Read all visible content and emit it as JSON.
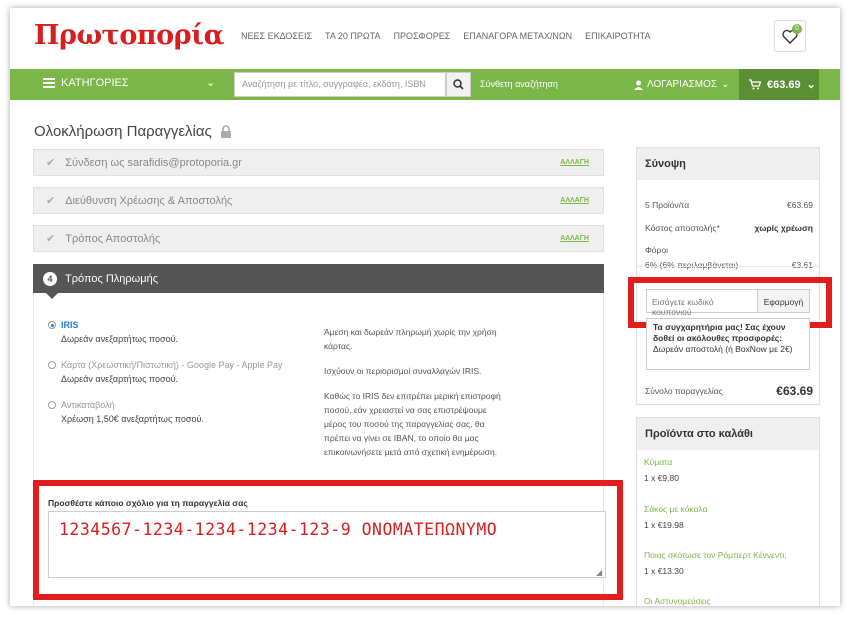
{
  "header": {
    "logo": "Πρωτοπορία",
    "nav": [
      "ΝΕΕΣ ΕΚΔΟΣΕΙΣ",
      "ΤΑ 20 ΠΡΩΤΑ",
      "ΠΡΟΣΦΟΡΕΣ",
      "ΕΠΑΝΑΓΟΡΑ ΜΕΤΑΧ/ΝΩΝ",
      "ΕΠΙΚΑΙΡΟΤΗΤΑ"
    ],
    "wishlist_count": "0"
  },
  "greenbar": {
    "categories_label": "ΚΑΤΗΓΟΡΙΕΣ",
    "search_placeholder": "Αναζήτηση με τίτλο, συγγραφέα, εκδότη, ISBN",
    "advanced_search": "Σύνθετη αναζήτηση",
    "account_label": "ΛΟΓΑΡΙΑΣΜΟΣ",
    "cart_total": "€63.69",
    "cart_count": "5"
  },
  "page": {
    "title": "Ολοκλήρωση Παραγγελίας",
    "change_label": "ΑΛΛΑΓΗ",
    "steps": [
      "Σύνδεση ως sarafidis@protoporia.gr",
      "Διεύθυνση Χρέωσης & Αποστολής",
      "Τρόπος Αποστολής"
    ],
    "payment": {
      "number": "4",
      "title": "Τρόπος Πληρωμής",
      "options": [
        {
          "name": "IRIS",
          "sub": "Δωρεάν ανεξαρτήτως ποσού.",
          "selected": true
        },
        {
          "name": "Κάρτα (Χρεωστική/Πιστωτική) - Google Pay - Apple Pay",
          "sub": "Δωρεάν ανεξαρτήτως ποσού.",
          "selected": false
        },
        {
          "name": "Αντικαταβολή",
          "sub": "Χρέωση 1,50€ ανεξαρτήτως ποσού.",
          "selected": false
        }
      ],
      "desc1": "Άμεση και δωρεάν πληρωμή χωρίς την χρήση κάρτας.",
      "desc2": "Ισχύουν οι περιορισμοί συναλλαγών IRIS.",
      "desc3": "Καθώς το IRIS δεν επιτρέπει μερική επιστροφή ποσού, εάν χρειαστεί να σας επιστρέψουμε μέρος του ποσού της παραγγελίας σας, θα πρέπει να γίνει σε IBAN, το οποίο θα μας επικοινωνήσετε μετά από σχετική ενημέρωση."
    },
    "comment": {
      "label": "Προσθέστε κάποιο σχόλιο για τη παραγγελία σας",
      "value": "1234567-1234-1234-1234-123-9 ΟΝΟΜΑΤΕΠΩΝΥΜΟ"
    }
  },
  "summary": {
    "title": "Σύνοψη",
    "products_label": "5 Προϊόν/τα",
    "products_value": "€63.69",
    "shipping_label": "Κόστος αποστολής*",
    "shipping_value": "χωρίς χρέωση",
    "tax_label": "Φόροι",
    "tax_detail": "6% (6% περιλαμβάνεται)",
    "tax_value": "€3.61",
    "coupon_placeholder": "Εισάγετε κωδικό κουπονιού",
    "coupon_button": "Εφαρμογή",
    "promo_line1": "Τα συγχαρητήρια μας! Σας έχουν",
    "promo_line2": "δοθεί οι ακόλουθες προσφορές:",
    "promo_line3": "Δωρεάν αποστολή (ή BoxNow με 2€)",
    "total_label": "Σύνολο παραγγελίας",
    "total_value": "€63.69"
  },
  "cart_products": {
    "title": "Προϊόντα στο καλάθι",
    "items": [
      {
        "name": "Κύματα",
        "qty": "1 x €9.80"
      },
      {
        "name": "Σάκος με κόκαλα",
        "qty": "1 x €19.98"
      },
      {
        "name": "Ποιος σκότωσε τον Ρόμπερτ Κέννεντι;",
        "qty": "1 x €13.30"
      },
      {
        "name": "Οι Αστυνομεύσεις",
        "qty": ""
      }
    ]
  }
}
